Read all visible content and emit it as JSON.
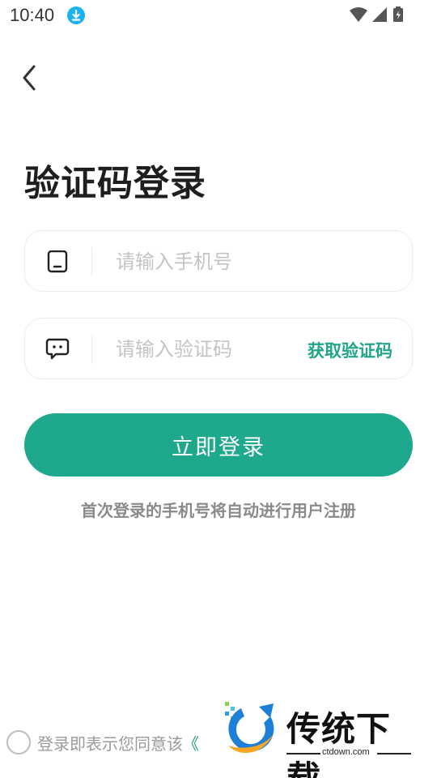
{
  "status_bar": {
    "time": "10:40",
    "icons": [
      "download-icon",
      "wifi-icon",
      "signal-icon",
      "battery-charging-icon"
    ]
  },
  "header": {
    "back_icon": "chevron-left-icon",
    "title": "验证码登录"
  },
  "form": {
    "phone": {
      "icon": "phone-icon",
      "placeholder": "请输入手机号",
      "value": ""
    },
    "code": {
      "icon": "message-icon",
      "placeholder": "请输入验证码",
      "value": "",
      "get_code_label": "获取验证码"
    },
    "submit_label": "立即登录",
    "hint": "首次登录的手机号将自动进行用户注册"
  },
  "agreement": {
    "checked": false,
    "text": "登录即表示您同意该",
    "link_partial": "《"
  },
  "watermark": {
    "name": "传统下载",
    "url": "ctdown.com"
  },
  "colors": {
    "accent": "#1ea88c",
    "accent_text": "#1fa58a",
    "title": "#1e1e1e",
    "placeholder": "#c4c4c4",
    "hint": "#8a8a8a",
    "border": "#ececec"
  }
}
